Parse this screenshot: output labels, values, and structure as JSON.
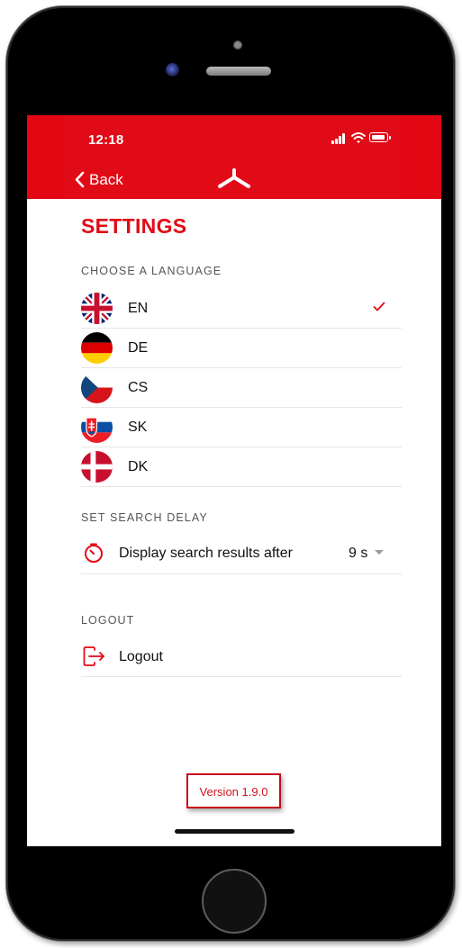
{
  "status_bar": {
    "time": "12:18"
  },
  "nav": {
    "back_label": "Back",
    "logo_icon": "brand-chevron-logo-icon"
  },
  "settings": {
    "title": "SETTINGS",
    "language_section": "CHOOSE A LANGUAGE",
    "languages": [
      {
        "code": "EN",
        "flag": "uk-flag-icon",
        "selected": true
      },
      {
        "code": "DE",
        "flag": "germany-flag-icon",
        "selected": false
      },
      {
        "code": "CS",
        "flag": "czech-flag-icon",
        "selected": false
      },
      {
        "code": "SK",
        "flag": "slovakia-flag-icon",
        "selected": false
      },
      {
        "code": "DK",
        "flag": "denmark-flag-icon",
        "selected": false
      }
    ],
    "search_delay_section": "SET SEARCH DELAY",
    "search_delay_label": "Display search results after",
    "search_delay_value": "9 s",
    "logout_section": "LOGOUT",
    "logout_label": "Logout",
    "version": "Version 1.9.0"
  },
  "colors": {
    "accent": "#e10a17",
    "text": "#111111",
    "section": "#555555",
    "divider": "#e6e6e6"
  }
}
